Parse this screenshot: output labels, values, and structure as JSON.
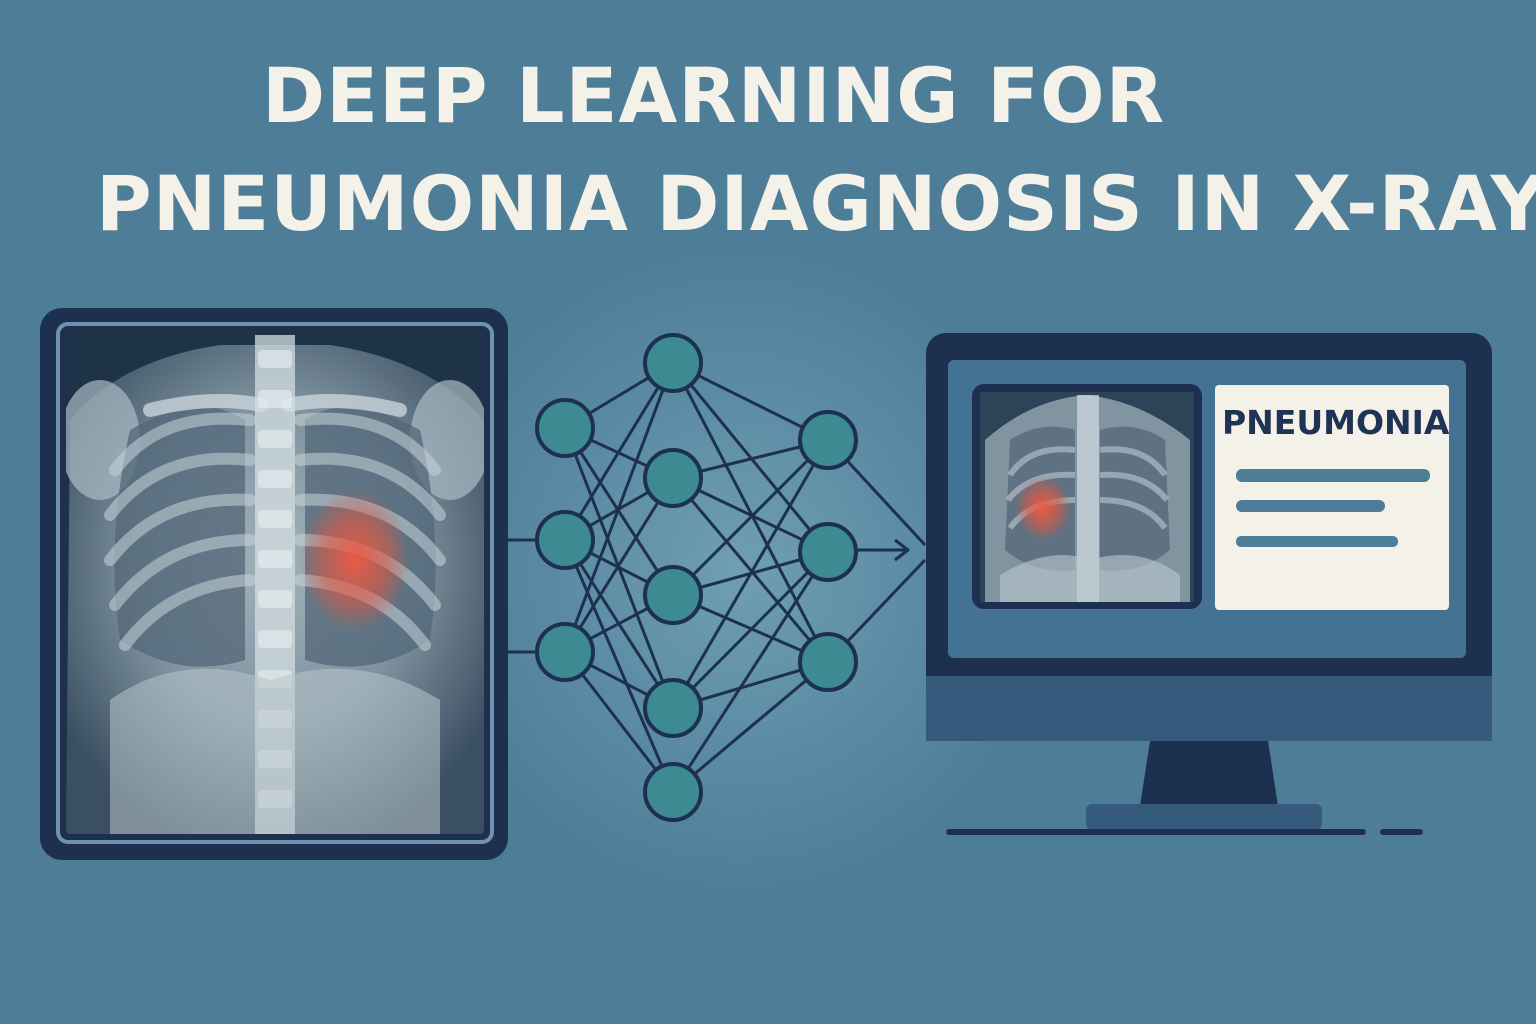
{
  "title": {
    "line1": "DEEP LEARNING FOR",
    "line2": "PNEUMONIA DIAGNOSIS IN X-RAYS"
  },
  "monitor": {
    "result_label": "PNEUMONIA"
  },
  "colors": {
    "background": "#4e7d98",
    "title_text": "#f4f1e8",
    "frame_dark": "#1d3050",
    "node_fill": "#3d8a92",
    "highlight": "#e5553f"
  },
  "icons": {
    "xray": "chest-xray-image",
    "network": "neural-network-diagram",
    "monitor": "computer-monitor"
  }
}
